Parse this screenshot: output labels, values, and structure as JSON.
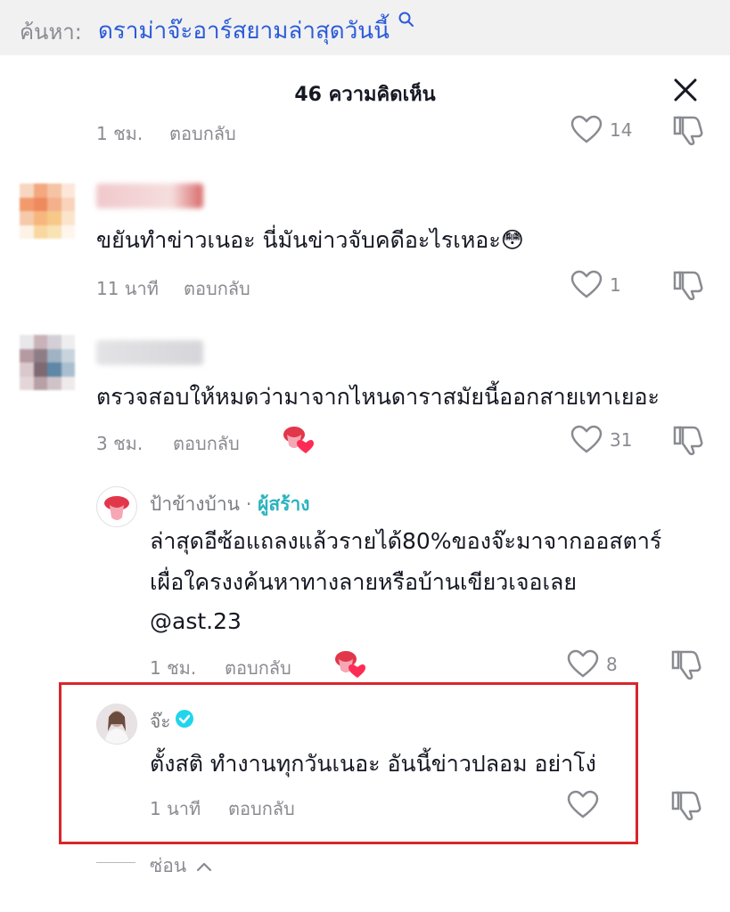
{
  "search": {
    "label": "ค้นหา:",
    "term": "ดราม่าจ๊ะอาร์สยามล่าสุดวันนี้"
  },
  "header": {
    "title": "46 ความคิดเห็น"
  },
  "top_partial": {
    "time": "1 ชม.",
    "reply_label": "ตอบกลับ",
    "likes": "14"
  },
  "comments": [
    {
      "text": "ขยันทำข่าวเนอะ นี่มันข่าวจับคดีอะไรเหอะ😳",
      "time": "11 นาที",
      "reply_label": "ตอบกลับ",
      "likes": "1"
    },
    {
      "text": "ตรวจสอบให้หมดว่ามาจากไหนดาราสมัยนี้ออกสายเทาเยอะ",
      "time": "3 ชม.",
      "reply_label": "ตอบกลับ",
      "likes": "31"
    }
  ],
  "replies": [
    {
      "author": "ป้าข้างบ้าน",
      "separator": "·",
      "creator_badge": "ผู้สร้าง",
      "text_lines": [
        "ล่าสุดอีซ้อแถลงแล้วรายได้80%ของจ๊ะมาจากออสตาร์",
        "เผื่อใครงงค้นหาทางลายหรือบ้านเขียวเจอเลย",
        "@ast.23"
      ],
      "time": "1 ชม.",
      "reply_label": "ตอบกลับ",
      "likes": "8"
    },
    {
      "author": "จ๊ะ",
      "verified_icon": "verified-check-icon",
      "text": "ตั้งสติ ทำงานทุกวันเนอะ อันนี้ข่าวปลอม อย่าโง่",
      "time": "1 นาที",
      "reply_label": "ตอบกลับ"
    }
  ],
  "footer": {
    "hide_label": "ซ่อน"
  },
  "colors": {
    "link_blue": "#2b5bd7",
    "creator_teal": "#2bb3c0",
    "verified_cyan": "#20d5ec",
    "highlight_red": "#d8262b",
    "meta_gray": "#8a8b91"
  }
}
